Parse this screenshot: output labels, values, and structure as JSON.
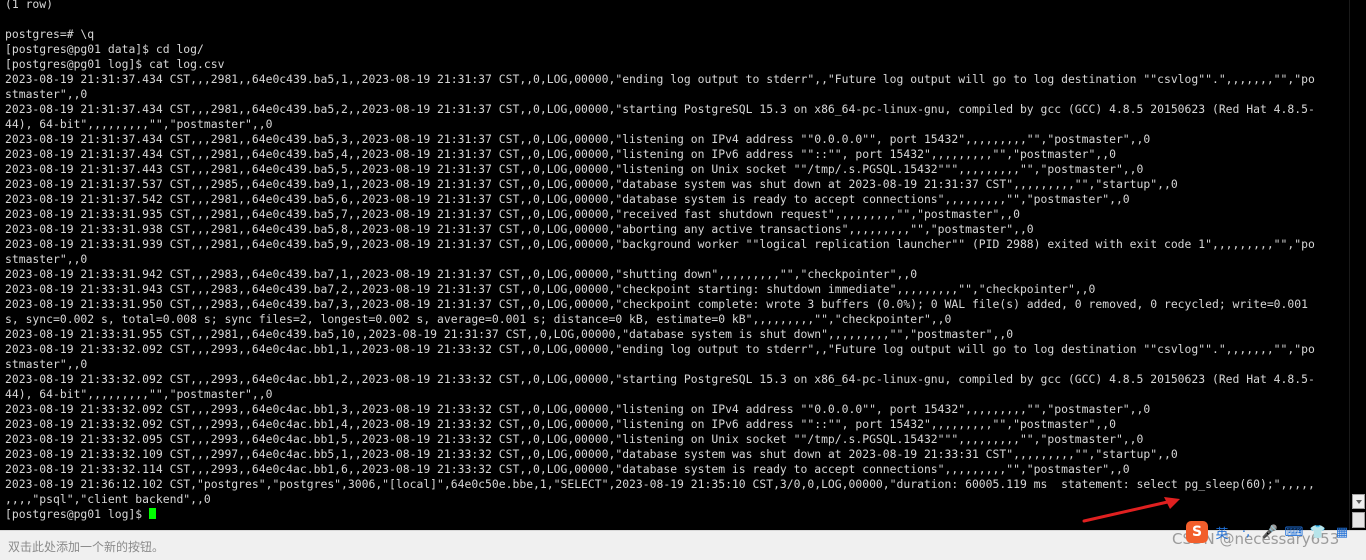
{
  "terminal": {
    "lines": [
      "(1 row)",
      "",
      "postgres=# \\q",
      "[postgres@pg01 data]$ cd log/",
      "[postgres@pg01 log]$ cat log.csv",
      "2023-08-19 21:31:37.434 CST,,,2981,,64e0c439.ba5,1,,2023-08-19 21:31:37 CST,,0,LOG,00000,\"ending log output to stderr\",,\"Future log output will go to log destination \"\"csvlog\"\".\",,,,,,,\"\",\"po",
      "stmaster\",,0",
      "2023-08-19 21:31:37.434 CST,,,2981,,64e0c439.ba5,2,,2023-08-19 21:31:37 CST,,0,LOG,00000,\"starting PostgreSQL 15.3 on x86_64-pc-linux-gnu, compiled by gcc (GCC) 4.8.5 20150623 (Red Hat 4.8.5-",
      "44), 64-bit\",,,,,,,,,\"\",\"postmaster\",,0",
      "2023-08-19 21:31:37.434 CST,,,2981,,64e0c439.ba5,3,,2023-08-19 21:31:37 CST,,0,LOG,00000,\"listening on IPv4 address \"\"0.0.0.0\"\", port 15432\",,,,,,,,,\"\",\"postmaster\",,0",
      "2023-08-19 21:31:37.434 CST,,,2981,,64e0c439.ba5,4,,2023-08-19 21:31:37 CST,,0,LOG,00000,\"listening on IPv6 address \"\"::\"\", port 15432\",,,,,,,,,\"\",\"postmaster\",,0",
      "2023-08-19 21:31:37.443 CST,,,2981,,64e0c439.ba5,5,,2023-08-19 21:31:37 CST,,0,LOG,00000,\"listening on Unix socket \"\"/tmp/.s.PGSQL.15432\"\"\",,,,,,,,,\"\",\"postmaster\",,0",
      "2023-08-19 21:31:37.537 CST,,,2985,,64e0c439.ba9,1,,2023-08-19 21:31:37 CST,,0,LOG,00000,\"database system was shut down at 2023-08-19 21:31:37 CST\",,,,,,,,,\"\",\"startup\",,0",
      "2023-08-19 21:31:37.542 CST,,,2981,,64e0c439.ba5,6,,2023-08-19 21:31:37 CST,,0,LOG,00000,\"database system is ready to accept connections\",,,,,,,,,\"\",\"postmaster\",,0",
      "2023-08-19 21:33:31.935 CST,,,2981,,64e0c439.ba5,7,,2023-08-19 21:31:37 CST,,0,LOG,00000,\"received fast shutdown request\",,,,,,,,,\"\",\"postmaster\",,0",
      "2023-08-19 21:33:31.938 CST,,,2981,,64e0c439.ba5,8,,2023-08-19 21:31:37 CST,,0,LOG,00000,\"aborting any active transactions\",,,,,,,,,\"\",\"postmaster\",,0",
      "2023-08-19 21:33:31.939 CST,,,2981,,64e0c439.ba5,9,,2023-08-19 21:31:37 CST,,0,LOG,00000,\"background worker \"\"logical replication launcher\"\" (PID 2988) exited with exit code 1\",,,,,,,,,\"\",\"po",
      "stmaster\",,0",
      "2023-08-19 21:33:31.942 CST,,,2983,,64e0c439.ba7,1,,2023-08-19 21:31:37 CST,,0,LOG,00000,\"shutting down\",,,,,,,,,\"\",\"checkpointer\",,0",
      "2023-08-19 21:33:31.943 CST,,,2983,,64e0c439.ba7,2,,2023-08-19 21:31:37 CST,,0,LOG,00000,\"checkpoint starting: shutdown immediate\",,,,,,,,,\"\",\"checkpointer\",,0",
      "2023-08-19 21:33:31.950 CST,,,2983,,64e0c439.ba7,3,,2023-08-19 21:31:37 CST,,0,LOG,00000,\"checkpoint complete: wrote 3 buffers (0.0%); 0 WAL file(s) added, 0 removed, 0 recycled; write=0.001",
      "s, sync=0.002 s, total=0.008 s; sync files=2, longest=0.002 s, average=0.001 s; distance=0 kB, estimate=0 kB\",,,,,,,,,\"\",\"checkpointer\",,0",
      "2023-08-19 21:33:31.955 CST,,,2981,,64e0c439.ba5,10,,2023-08-19 21:31:37 CST,,0,LOG,00000,\"database system is shut down\",,,,,,,,,\"\",\"postmaster\",,0",
      "2023-08-19 21:33:32.092 CST,,,2993,,64e0c4ac.bb1,1,,2023-08-19 21:33:32 CST,,0,LOG,00000,\"ending log output to stderr\",,\"Future log output will go to log destination \"\"csvlog\"\".\",,,,,,,\"\",\"po",
      "stmaster\",,0",
      "2023-08-19 21:33:32.092 CST,,,2993,,64e0c4ac.bb1,2,,2023-08-19 21:33:32 CST,,0,LOG,00000,\"starting PostgreSQL 15.3 on x86_64-pc-linux-gnu, compiled by gcc (GCC) 4.8.5 20150623 (Red Hat 4.8.5-",
      "44), 64-bit\",,,,,,,,,\"\",\"postmaster\",,0",
      "2023-08-19 21:33:32.092 CST,,,2993,,64e0c4ac.bb1,3,,2023-08-19 21:33:32 CST,,0,LOG,00000,\"listening on IPv4 address \"\"0.0.0.0\"\", port 15432\",,,,,,,,,\"\",\"postmaster\",,0",
      "2023-08-19 21:33:32.092 CST,,,2993,,64e0c4ac.bb1,4,,2023-08-19 21:33:32 CST,,0,LOG,00000,\"listening on IPv6 address \"\"::\"\", port 15432\",,,,,,,,,\"\",\"postmaster\",,0",
      "2023-08-19 21:33:32.095 CST,,,2993,,64e0c4ac.bb1,5,,2023-08-19 21:33:32 CST,,0,LOG,00000,\"listening on Unix socket \"\"/tmp/.s.PGSQL.15432\"\"\",,,,,,,,,\"\",\"postmaster\",,0",
      "2023-08-19 21:33:32.109 CST,,,2997,,64e0c4ac.bb5,1,,2023-08-19 21:33:32 CST,,0,LOG,00000,\"database system was shut down at 2023-08-19 21:33:31 CST\",,,,,,,,,\"\",\"startup\",,0",
      "2023-08-19 21:33:32.114 CST,,,2993,,64e0c4ac.bb1,6,,2023-08-19 21:33:32 CST,,0,LOG,00000,\"database system is ready to accept connections\",,,,,,,,,\"\",\"postmaster\",,0",
      "2023-08-19 21:36:12.102 CST,\"postgres\",\"postgres\",3006,\"[local]\",64e0c50e.bbe,1,\"SELECT\",2023-08-19 21:35:10 CST,3/0,0,LOG,00000,\"duration: 60005.119 ms  statement: select pg_sleep(60);\",,,,,",
      ",,,,\"psql\",\"client backend\",,0"
    ],
    "prompt": "[postgres@pg01 log]$ ",
    "text_color": "#d7d7d7",
    "cursor_color": "#00ff00",
    "background": "#000000"
  },
  "statusbar": {
    "hint": "双击此处添加一个新的按钮。"
  },
  "ime": {
    "logo": "S",
    "items": [
      {
        "name": "chinese-mode-icon",
        "glyph": "英"
      },
      {
        "name": "punctuation-icon",
        "glyph": "·,"
      },
      {
        "name": "microphone-icon",
        "glyph": "🎤"
      },
      {
        "name": "keyboard-icon",
        "glyph": "⌨"
      },
      {
        "name": "skin-icon",
        "glyph": "👕"
      },
      {
        "name": "toolbox-icon",
        "glyph": "▦"
      }
    ]
  },
  "watermark": "CSDN @necessary653"
}
